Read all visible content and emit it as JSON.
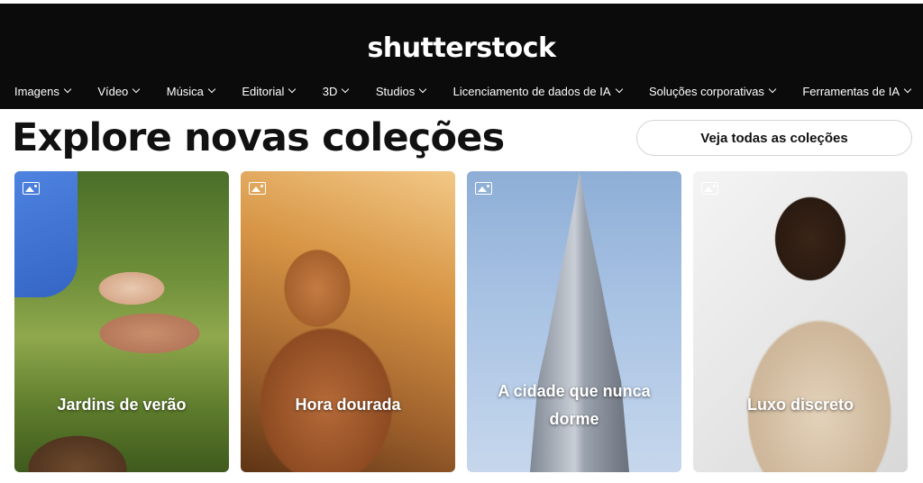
{
  "header": {
    "logo": "shutterstock",
    "nav": [
      {
        "label": "Imagens"
      },
      {
        "label": "Vídeo"
      },
      {
        "label": "Música"
      },
      {
        "label": "Editorial"
      },
      {
        "label": "3D"
      },
      {
        "label": "Studios"
      },
      {
        "label": "Licenciamento de dados de IA"
      },
      {
        "label": "Soluções corporativas"
      },
      {
        "label": "Ferramentas de IA"
      }
    ]
  },
  "main": {
    "title": "Explore novas coleções",
    "view_all_button": "Veja todas as coleções",
    "collections": [
      {
        "label": "Jardins de verão",
        "icon": "image-icon"
      },
      {
        "label": "Hora dourada",
        "icon": "image-icon"
      },
      {
        "label": "A cidade que nunca dorme",
        "icon": "image-icon"
      },
      {
        "label": "Luxo discreto",
        "icon": "image-icon"
      }
    ]
  }
}
